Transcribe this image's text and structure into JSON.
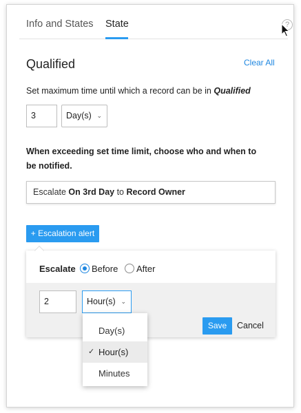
{
  "tabs": [
    {
      "label": "Info and States"
    },
    {
      "label": "State"
    }
  ],
  "help_icon": "question-circle-icon",
  "section_title": "Qualified",
  "clear_all": "Clear All",
  "max_time": {
    "prefix": "Set maximum time until which a record can be in ",
    "state": "Qualified",
    "value": "3",
    "unit": "Day(s)"
  },
  "notify_text": "When exceeding set time limit, choose who and when to be notified.",
  "escalation_summary": {
    "pre": "Escalate ",
    "when": "On 3rd Day",
    "mid": " to ",
    "who": "Record Owner"
  },
  "alert_button": "+ Escalation alert",
  "alert_card": {
    "label": "Escalate",
    "options": [
      "Before",
      "After"
    ],
    "selected": "Before",
    "value": "2",
    "unit": "Hour(s)",
    "save": "Save",
    "cancel": "Cancel"
  },
  "unit_dropdown": {
    "options": [
      "Day(s)",
      "Hour(s)",
      "Minutes"
    ],
    "selected": "Hour(s)"
  },
  "colors": {
    "accent": "#2a9bf0",
    "link": "#1d86e0"
  }
}
